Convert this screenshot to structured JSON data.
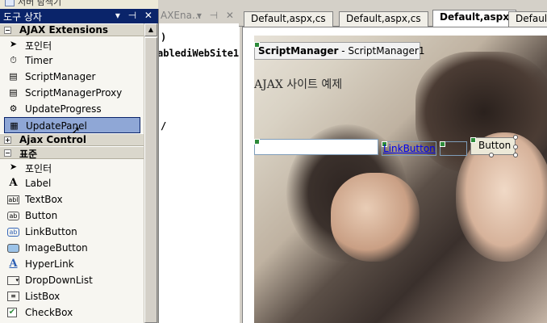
{
  "topstrip": {
    "label": "서버 탐색기"
  },
  "toolbox": {
    "title": "도구 상자",
    "title_buttons": "▾ ⊣ ✕",
    "groups": [
      {
        "label": "AJAX Extensions",
        "toggle": "−"
      },
      {
        "label": "Ajax Control",
        "toggle": "+"
      },
      {
        "label": "표준",
        "toggle": "−"
      }
    ],
    "ajax_items": [
      {
        "label": "포인터",
        "icon": "pointer-icon"
      },
      {
        "label": "Timer",
        "icon": "timer-icon"
      },
      {
        "label": "ScriptManager",
        "icon": "script-manager-icon"
      },
      {
        "label": "ScriptManagerProxy",
        "icon": "script-manager-proxy-icon"
      },
      {
        "label": "UpdateProgress",
        "icon": "update-progress-icon"
      },
      {
        "label": "UpdatePanel",
        "icon": "update-panel-icon"
      }
    ],
    "standard_items": [
      {
        "label": "포인터",
        "icon": "pointer-icon"
      },
      {
        "label": "Label",
        "icon": "label-icon"
      },
      {
        "label": "TextBox",
        "icon": "textbox-icon"
      },
      {
        "label": "Button",
        "icon": "button-icon"
      },
      {
        "label": "LinkButton",
        "icon": "linkbutton-icon"
      },
      {
        "label": "ImageButton",
        "icon": "imagebutton-icon"
      },
      {
        "label": "HyperLink",
        "icon": "hyperlink-icon"
      },
      {
        "label": "DropDownList",
        "icon": "dropdownlist-icon"
      },
      {
        "label": "ListBox",
        "icon": "listbox-icon"
      },
      {
        "label": "CheckBox",
        "icon": "checkbox-icon"
      }
    ]
  },
  "midpane": {
    "title": "AXEna...",
    "title_buttons": "▾ ⊣ ✕",
    "lines": [
      ")",
      "ablediWebSite1",
      "/"
    ]
  },
  "tabs": [
    {
      "label": "Default,aspx,cs",
      "active": false
    },
    {
      "label": "Default,aspx,cs",
      "active": false
    },
    {
      "label": "Default,aspx",
      "active": true
    },
    {
      "label": "Default,",
      "active": false
    }
  ],
  "design": {
    "script_manager_name": "ScriptManager",
    "script_manager_id": " - ScriptManager1",
    "heading": "AJAX 사이트 예제",
    "link_button": "LinkButton",
    "image_button": "",
    "button": "Button"
  }
}
